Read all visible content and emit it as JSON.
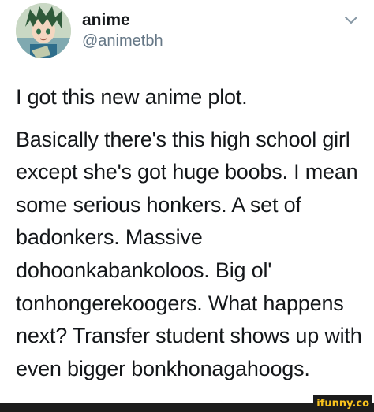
{
  "tweet": {
    "display_name": "anime",
    "handle": "@animetbh",
    "menu_icon": "chevron-down-icon",
    "avatar_icon": "anime-character-avatar",
    "paragraphs": [
      "I got this new anime plot.",
      "Basically there's this high school girl except she's got huge boobs. I mean some serious honkers. A set of badonkers. Massive dohoonkabankoloos. Big ol' tonhongerekoogers. What happens next? Transfer student shows up with even bigger bonkhonagahoogs."
    ]
  },
  "watermark": {
    "text": "ifunny.co"
  },
  "colors": {
    "text": "#14171a",
    "handle": "#657786",
    "watermark_fg": "#f8c21c",
    "watermark_bg": "#1c1c1c"
  }
}
